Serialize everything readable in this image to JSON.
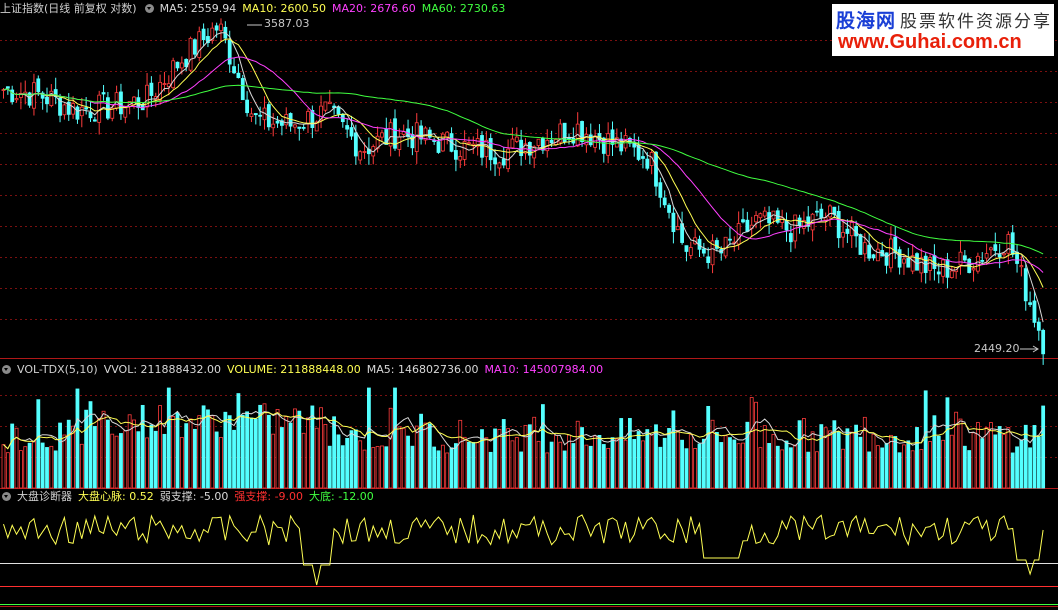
{
  "price_panel": {
    "title": "上证指数(日线 前复权 对数)",
    "ma_labels": [
      {
        "text": "MA5: 2559.94",
        "color": "#d8d8d8"
      },
      {
        "text": "MA10: 2600.50",
        "color": "#ffff54"
      },
      {
        "text": "MA20: 2676.60",
        "color": "#ff40ff"
      },
      {
        "text": "MA60: 2730.63",
        "color": "#40ff40"
      }
    ],
    "high_label": "3587.03",
    "low_label": "2449.20"
  },
  "volume_panel": {
    "title": "VOL-TDX(5,10)",
    "labels": [
      {
        "text": "VVOL: 211888432.00",
        "color": "#d8d8d8"
      },
      {
        "text": "VOLUME: 211888448.00",
        "color": "#ffff54"
      },
      {
        "text": "MA5: 146802736.00",
        "color": "#d8d8d8"
      },
      {
        "text": "MA10: 145007984.00",
        "color": "#ff40ff"
      }
    ]
  },
  "indicator_panel": {
    "title": "大盘诊断器",
    "labels": [
      {
        "text": "大盘心脉: 0.52",
        "color": "#ffff54"
      },
      {
        "text": "弱支撑: -5.00",
        "color": "#d8d8d8"
      },
      {
        "text": "强支撑: -9.00",
        "color": "#ff3030"
      },
      {
        "text": "大底: -12.00",
        "color": "#40ff40"
      }
    ]
  },
  "logo": {
    "line1_brand": "股海网",
    "line1_tagline": "股票软件资源分享",
    "line2": "www.Guhai.com.cn"
  },
  "colors": {
    "up": "#ff3c3c",
    "down": "#54ffff",
    "ma5": "#d8d8d8",
    "ma10": "#ffff54",
    "ma20": "#ff40ff",
    "ma60": "#40ff40",
    "grid": "#7a1010"
  },
  "chart_data": {
    "type": "candlestick",
    "price_high": 3587.03,
    "price_low": 2449.2,
    "price_trend": [
      3320,
      3300,
      3240,
      3250,
      3280,
      3450,
      3587,
      3200,
      3180,
      3230,
      3090,
      3150,
      3120,
      3090,
      3080,
      3130,
      3170,
      3110,
      3060,
      2740,
      2720,
      2830,
      2800,
      2850,
      2740,
      2720,
      2660,
      2700,
      2770,
      2449
    ],
    "ma_values": {
      "MA5": 2559.94,
      "MA10": 2600.5,
      "MA20": 2676.6,
      "MA60": 2730.63
    },
    "volume_last": 211888448.0,
    "volume_ma5": 146802736.0,
    "volume_ma10": 145007984.0,
    "indicator": {
      "大盘心脉": 0.52,
      "弱支撑": -5.0,
      "强支撑": -9.0,
      "大底": -12.0
    }
  }
}
